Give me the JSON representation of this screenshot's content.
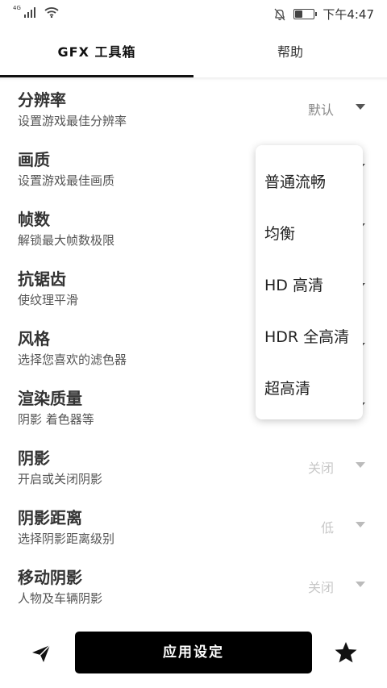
{
  "status_bar": {
    "network": "4G",
    "time": "下午4:47",
    "battery_level": 0.35
  },
  "tabs": [
    {
      "label": "GFX 工具箱",
      "active": true
    },
    {
      "label": "帮助",
      "active": false
    }
  ],
  "settings": [
    {
      "title": "分辨率",
      "subtitle": "设置游戏最佳分辨率",
      "value": "默认",
      "enabled": true
    },
    {
      "title": "画质",
      "subtitle": "设置游戏最佳画质",
      "value": "",
      "enabled": true
    },
    {
      "title": "帧数",
      "subtitle": "解锁最大帧数极限",
      "value": "",
      "enabled": true
    },
    {
      "title": "抗锯齿",
      "subtitle": "使纹理平滑",
      "value": "",
      "enabled": true
    },
    {
      "title": "风格",
      "subtitle": "选择您喜欢的滤色器",
      "value": "",
      "enabled": true
    },
    {
      "title": "渲染质量",
      "subtitle": "阴影 着色器等",
      "value": "",
      "enabled": true
    },
    {
      "title": "阴影",
      "subtitle": "开启或关闭阴影",
      "value": "关闭",
      "enabled": false
    },
    {
      "title": "阴影距离",
      "subtitle": "选择阴影距离级别",
      "value": "低",
      "enabled": false
    },
    {
      "title": "移动阴影",
      "subtitle": "人物及车辆阴影",
      "value": "关闭",
      "enabled": false
    }
  ],
  "dropdown": {
    "options": [
      "普通流畅",
      "均衡",
      "HD 高清",
      "HDR 全高清",
      "超高清"
    ]
  },
  "bottom_bar": {
    "apply_label": "应用设定"
  }
}
